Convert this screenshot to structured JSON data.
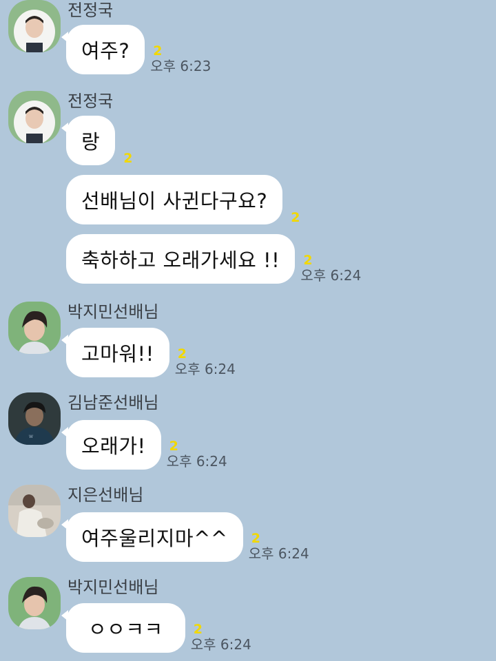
{
  "messages": [
    {
      "sender": "전정국",
      "avatar": "avatar-jungkook",
      "bubbles": [
        {
          "text": "여주?",
          "unread": "2",
          "time": "오후 6:23"
        }
      ]
    },
    {
      "sender": "전정국",
      "avatar": "avatar-jungkook",
      "bubbles": [
        {
          "text": "랑",
          "unread": "2",
          "time": ""
        },
        {
          "text": "선배님이 사귄다구요?",
          "unread": "2",
          "time": ""
        },
        {
          "text": "축하하고 오래가세요 !!",
          "unread": "2",
          "time": "오후 6:24"
        }
      ]
    },
    {
      "sender": "박지민선배님",
      "avatar": "avatar-jimin",
      "bubbles": [
        {
          "text": "고마워!!",
          "unread": "2",
          "time": "오후 6:24"
        }
      ]
    },
    {
      "sender": "김남준선배님",
      "avatar": "avatar-namjoon",
      "bubbles": [
        {
          "text": "오래가!",
          "unread": "2",
          "time": "오후 6:24"
        }
      ]
    },
    {
      "sender": "지은선배님",
      "avatar": "avatar-jieun",
      "bubbles": [
        {
          "text": "여주울리지마^^",
          "unread": "2",
          "time": "오후 6:24"
        }
      ]
    },
    {
      "sender": "박지민선배님",
      "avatar": "avatar-jimin",
      "bubbles": [
        {
          "text": "ㅇㅇㅋㅋ",
          "unread": "2",
          "time": "오후 6:24"
        }
      ]
    }
  ],
  "colors": {
    "background": "#b1c7da",
    "bubble": "#ffffff",
    "unread": "#f2d800",
    "time": "#4b5560"
  }
}
